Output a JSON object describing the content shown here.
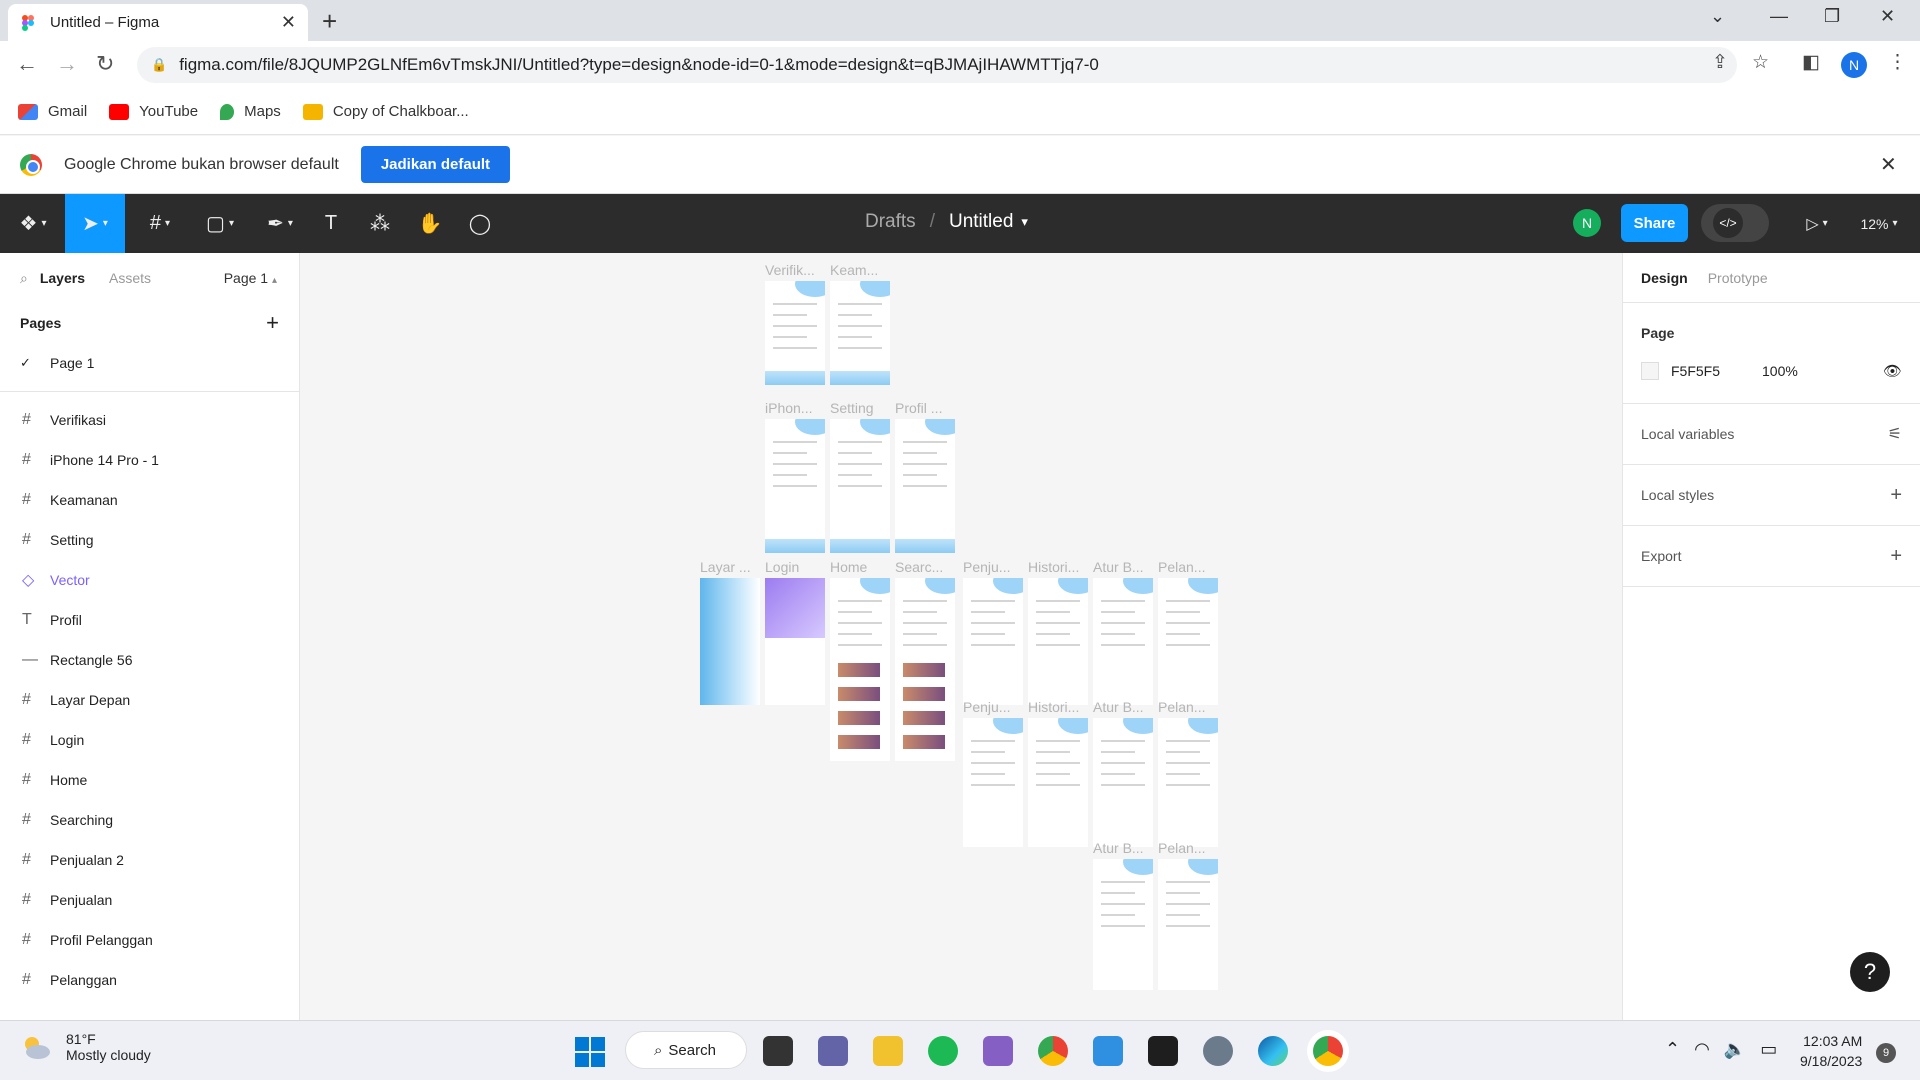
{
  "browser": {
    "tab_title": "Untitled – Figma",
    "url": "figma.com/file/8JQUMP2GLNfEm6vTmskJNI/Untitled?type=design&node-id=0-1&mode=design&t=qBJMAjIHAWMTTjq7-0",
    "profile_initial": "N",
    "bookmarks": [
      "Gmail",
      "YouTube",
      "Maps",
      "Copy of Chalkboar..."
    ],
    "infobar_text": "Google Chrome bukan browser default",
    "infobar_button": "Jadikan default"
  },
  "figma": {
    "breadcrumb_parent": "Drafts",
    "breadcrumb_sep": "/",
    "file_name": "Untitled",
    "user_initial": "N",
    "share_label": "Share",
    "zoom": "12%",
    "left_panel": {
      "tab_layers": "Layers",
      "tab_assets": "Assets",
      "current_page": "Page 1",
      "pages_heading": "Pages",
      "pages": [
        "Page 1"
      ],
      "layers": [
        {
          "name": "Verifikasi",
          "type": "frame"
        },
        {
          "name": "iPhone 14 Pro - 1",
          "type": "frame"
        },
        {
          "name": "Keamanan",
          "type": "frame"
        },
        {
          "name": "Setting",
          "type": "frame"
        },
        {
          "name": "Vector",
          "type": "vector"
        },
        {
          "name": "Profil",
          "type": "text"
        },
        {
          "name": "Rectangle 56",
          "type": "rect"
        },
        {
          "name": "Layar Depan",
          "type": "frame"
        },
        {
          "name": "Login",
          "type": "frame"
        },
        {
          "name": "Home",
          "type": "frame"
        },
        {
          "name": "Searching",
          "type": "frame"
        },
        {
          "name": "Penjualan 2",
          "type": "frame"
        },
        {
          "name": "Penjualan",
          "type": "frame"
        },
        {
          "name": "Profil Pelanggan",
          "type": "frame"
        },
        {
          "name": "Pelanggan",
          "type": "frame"
        }
      ]
    },
    "right_panel": {
      "tab_design": "Design",
      "tab_prototype": "Prototype",
      "page_heading": "Page",
      "page_color": "F5F5F5",
      "page_opacity": "100%",
      "local_variables": "Local variables",
      "local_styles": "Local styles",
      "export": "Export"
    },
    "canvas_labels": [
      "Verifik...",
      "Keam...",
      "iPhon...",
      "Setting",
      "Profil ...",
      "Layar ...",
      "Login",
      "Home",
      "Searc...",
      "Penju...",
      "Histori...",
      "Atur B...",
      "Pelan...",
      "Penju...",
      "Histori...",
      "Atur B...",
      "Pelan...",
      "Atur B...",
      "Pelan..."
    ],
    "help": "?"
  },
  "taskbar": {
    "temperature": "81°F",
    "weather": "Mostly cloudy",
    "search": "Search",
    "time": "12:03 AM",
    "date": "9/18/2023",
    "notifications": "9"
  },
  "colors": {
    "figma_blue": "#0d99ff",
    "chrome_blue": "#1a73e8",
    "toolbar": "#2c2c2c"
  }
}
